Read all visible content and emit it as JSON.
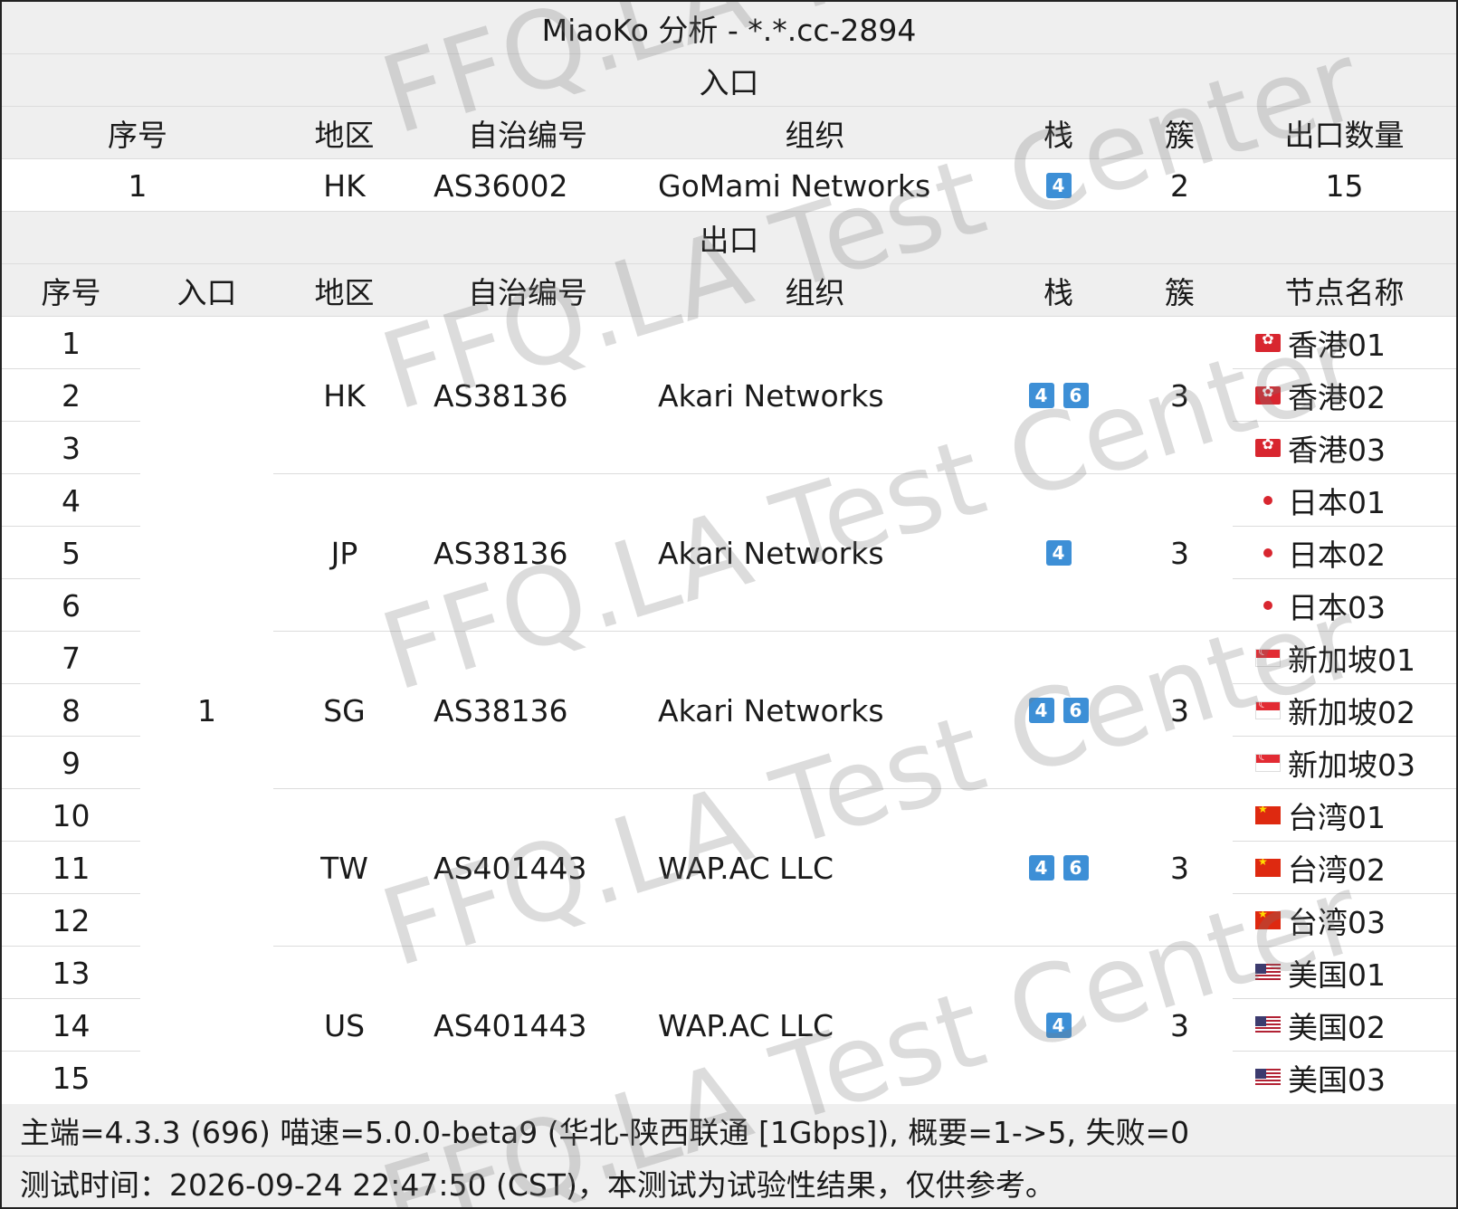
{
  "title": "MiaoKo 分析 - *.*.cc-2894",
  "entry_section": {
    "label": "入口",
    "headers": [
      "序号",
      "地区",
      "自治编号",
      "组织",
      "栈",
      "簇",
      "出口数量"
    ],
    "row": {
      "index": "1",
      "region": "HK",
      "asn": "AS36002",
      "org": "GoMami Networks",
      "stack": [
        "4"
      ],
      "cluster": "2",
      "exit_count": "15"
    }
  },
  "exit_section": {
    "label": "出口",
    "headers": [
      "序号",
      "入口",
      "地区",
      "自治编号",
      "组织",
      "栈",
      "簇",
      "节点名称"
    ],
    "entry_value": "1",
    "groups": [
      {
        "region": "HK",
        "asn": "AS38136",
        "org": "Akari Networks",
        "stack": [
          "4",
          "6"
        ],
        "cluster": "3",
        "flag": "hk-flag-icon",
        "nodes": [
          {
            "index": "1",
            "name": "香港01"
          },
          {
            "index": "2",
            "name": "香港02"
          },
          {
            "index": "3",
            "name": "香港03"
          }
        ]
      },
      {
        "region": "JP",
        "asn": "AS38136",
        "org": "Akari Networks",
        "stack": [
          "4"
        ],
        "cluster": "3",
        "flag": "jp-flag-icon",
        "nodes": [
          {
            "index": "4",
            "name": "日本01"
          },
          {
            "index": "5",
            "name": "日本02"
          },
          {
            "index": "6",
            "name": "日本03"
          }
        ]
      },
      {
        "region": "SG",
        "asn": "AS38136",
        "org": "Akari Networks",
        "stack": [
          "4",
          "6"
        ],
        "cluster": "3",
        "flag": "sg-flag-icon",
        "nodes": [
          {
            "index": "7",
            "name": "新加坡01"
          },
          {
            "index": "8",
            "name": "新加坡02"
          },
          {
            "index": "9",
            "name": "新加坡03"
          }
        ]
      },
      {
        "region": "TW",
        "asn": "AS401443",
        "org": "WAP.AC LLC",
        "stack": [
          "4",
          "6"
        ],
        "cluster": "3",
        "flag": "cn-flag-icon",
        "nodes": [
          {
            "index": "10",
            "name": "台湾01"
          },
          {
            "index": "11",
            "name": "台湾02"
          },
          {
            "index": "12",
            "name": "台湾03"
          }
        ]
      },
      {
        "region": "US",
        "asn": "AS401443",
        "org": "WAP.AC LLC",
        "stack": [
          "4"
        ],
        "cluster": "3",
        "flag": "us-flag-icon",
        "nodes": [
          {
            "index": "13",
            "name": "美国01"
          },
          {
            "index": "14",
            "name": "美国02"
          },
          {
            "index": "15",
            "name": "美国03"
          }
        ]
      }
    ]
  },
  "footer": {
    "line1": "主端=4.3.3 (696) 喵速=5.0.0-beta9 (华北-陕西联通 [1Gbps]), 概要=1->5, 失败=0",
    "line2": "测试时间：2026-09-24 22:47:50 (CST)，本测试为试验性结果，仅供参考。"
  },
  "watermark": "FFQ.LA Test Center",
  "colors": {
    "header_bg": "#efefef",
    "badge": "#3d8fd6",
    "border": "#dcdcdc"
  }
}
